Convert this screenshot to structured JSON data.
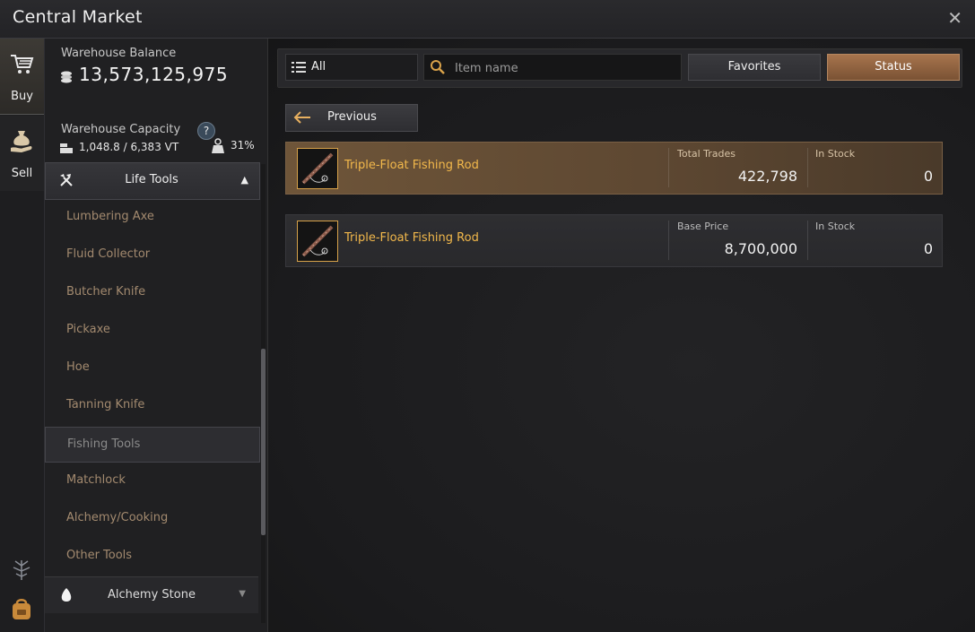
{
  "window": {
    "title": "Central Market",
    "close_icon": "close-icon"
  },
  "nav": {
    "buy_label": "Buy",
    "sell_label": "Sell"
  },
  "warehouse": {
    "balance_label": "Warehouse Balance",
    "balance_value": "13,573,125,975",
    "capacity_label": "Warehouse Capacity",
    "help": "?",
    "capacity_value": "1,048.8 / 6,383 VT",
    "capacity_pct": "31%"
  },
  "categories": {
    "current": {
      "label": "Life Tools"
    },
    "items": [
      {
        "label": "Lumbering Axe"
      },
      {
        "label": "Fluid Collector"
      },
      {
        "label": "Butcher Knife"
      },
      {
        "label": "Pickaxe"
      },
      {
        "label": "Hoe"
      },
      {
        "label": "Tanning Knife"
      },
      {
        "label": "Fishing Tools"
      },
      {
        "label": "Matchlock"
      },
      {
        "label": "Alchemy/Cooking"
      },
      {
        "label": "Other Tools"
      }
    ],
    "active_index": 6,
    "next": {
      "label": "Alchemy Stone"
    }
  },
  "toolbar": {
    "filter_label": "All",
    "search_placeholder": "Item name",
    "favorites_label": "Favorites",
    "status_label": "Status"
  },
  "previous_label": "Previous",
  "rows": [
    {
      "name": "Triple-Float Fishing Rod",
      "label1": "Total Trades",
      "value1": "422,798",
      "label2": "In Stock",
      "value2": "0"
    },
    {
      "name": "Triple-Float Fishing Rod",
      "label1": "Base Price",
      "value1": "8,700,000",
      "label2": "In Stock",
      "value2": "0"
    }
  ],
  "colors": {
    "accent": "#a7744d",
    "item_name": "#f2b84b",
    "category_text": "#a38a6f"
  }
}
